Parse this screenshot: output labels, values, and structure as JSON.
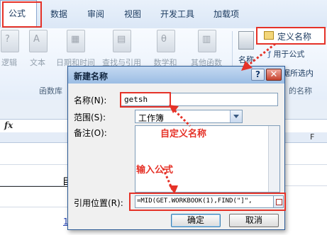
{
  "ribbon": {
    "tabs": [
      "公式",
      "数据",
      "审阅",
      "视图",
      "开发工具",
      "加载项"
    ],
    "buttons": [
      {
        "label": "逻辑",
        "icon": "logic-icon"
      },
      {
        "label": "文本",
        "icon": "text-a-icon"
      },
      {
        "label": "日期和时间",
        "icon": "calendar-icon"
      },
      {
        "label": "查找与引用",
        "icon": "lookup-book-icon"
      },
      {
        "label": "数学和",
        "icon": "theta-icon"
      },
      {
        "label": "其他函数",
        "icon": "more-functions-icon"
      }
    ],
    "group_label": "函数库",
    "define_name": "定义名称",
    "name_manager_partial": "名称",
    "use_in_formula": "用于公式",
    "create_from_selection_partial": "据所选内",
    "defined_names_group_partial": "的名称"
  },
  "sheet": {
    "fx_label": "fx",
    "col_letter": "F",
    "row_partial_text": "目",
    "row_partial_number": "1"
  },
  "dialog": {
    "title": "新建名称",
    "help": "?",
    "close": "✕",
    "name_label": "名称(N):",
    "name_value": "getsh",
    "scope_label": "范围(S):",
    "scope_value": "工作簿",
    "comment_label": "备注(O):",
    "refers_label": "引用位置(R):",
    "refers_value": "=MID(GET.WORKBOOK(1),FIND(\"]\",",
    "ok": "确定",
    "cancel": "取消"
  },
  "annotations": {
    "custom_name": "自定义名称",
    "enter_formula": "输入公式"
  },
  "colors": {
    "annotation_red": "#e53228",
    "dialog_border": "#2b5a96",
    "title_bar": "#9bbde4"
  }
}
